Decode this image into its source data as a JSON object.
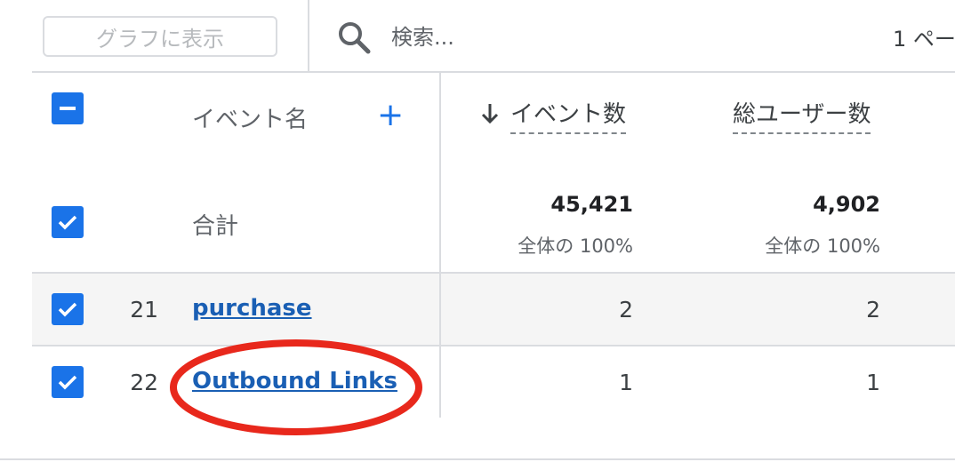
{
  "toolbar": {
    "chart_button_label": "グラフに表示",
    "search_placeholder": "検索...",
    "pager_text": "1 ペー"
  },
  "table": {
    "dimension_header": "イベント名",
    "metric_headers": [
      "イベント数",
      "総ユーザー数"
    ],
    "totals": {
      "label": "合計",
      "values": [
        "45,421",
        "4,902"
      ],
      "percents": [
        "全体の 100%",
        "全体の 100%"
      ]
    },
    "rows": [
      {
        "index": "21",
        "event_name": "purchase",
        "values": [
          "2",
          "2"
        ],
        "checked": true
      },
      {
        "index": "22",
        "event_name": "Outbound Links",
        "values": [
          "1",
          "1"
        ],
        "checked": true
      }
    ]
  },
  "colors": {
    "accent": "#1a73e8",
    "link": "#1a5fb4",
    "highlight_circle": "#e8281c",
    "row_highlight": "#f5f5f5"
  },
  "icons": [
    "search-icon",
    "indeterminate-checkbox-icon",
    "check-icon",
    "plus-icon",
    "arrow-down-icon"
  ]
}
